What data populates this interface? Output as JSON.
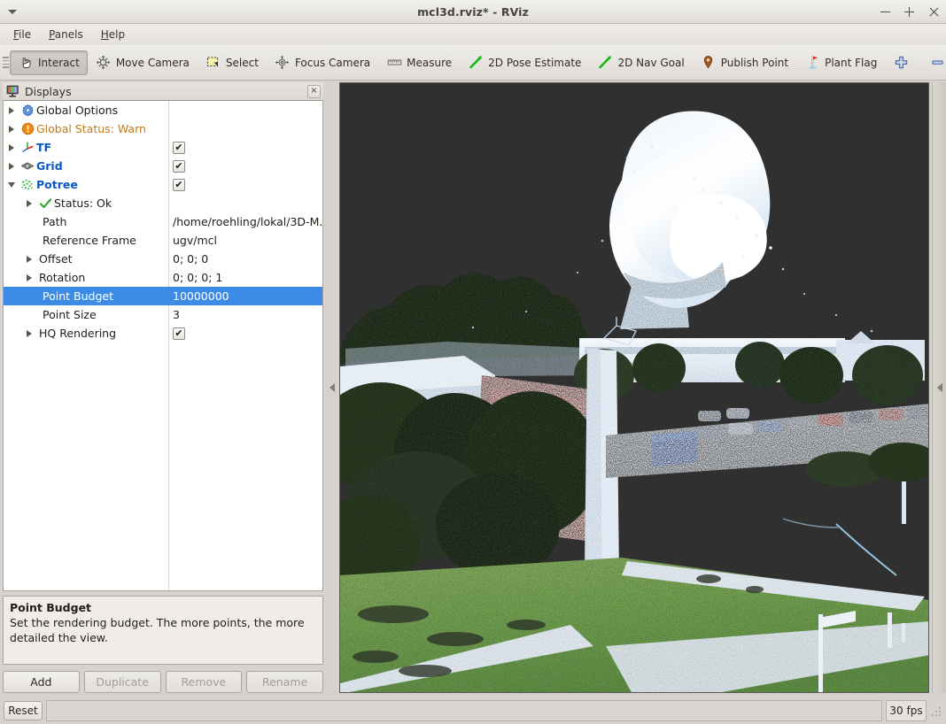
{
  "window": {
    "title": "mcl3d.rviz* - RViz",
    "minimize_label": "–",
    "maximize_label": "+",
    "close_label": "×"
  },
  "menubar": {
    "items": [
      {
        "label": "File"
      },
      {
        "label": "Panels"
      },
      {
        "label": "Help"
      }
    ]
  },
  "toolbar": {
    "items": [
      {
        "label": "Interact",
        "icon": "hand-cursor-icon",
        "checked": true
      },
      {
        "label": "Move Camera",
        "icon": "move-camera-icon",
        "checked": false
      },
      {
        "label": "Select",
        "icon": "select-rect-icon",
        "checked": false
      },
      {
        "label": "Focus Camera",
        "icon": "focus-camera-icon",
        "checked": false
      },
      {
        "label": "Measure",
        "icon": "ruler-icon",
        "checked": false
      },
      {
        "label": "2D Pose Estimate",
        "icon": "pose-arrow-icon",
        "checked": false
      },
      {
        "label": "2D Nav Goal",
        "icon": "nav-goal-arrow-icon",
        "checked": false
      },
      {
        "label": "Publish Point",
        "icon": "map-pin-icon",
        "checked": false
      },
      {
        "label": "Plant Flag",
        "icon": "flag-icon",
        "checked": false
      }
    ],
    "add_tool_label": "",
    "remove_tool_label": ""
  },
  "displays_panel": {
    "title": "Displays",
    "close_label": "×",
    "tree": [
      {
        "name": "Global Options",
        "value": "",
        "expander": "right",
        "icon": "gear-icon",
        "style": "plain",
        "checkbox": null,
        "indent": 0,
        "selected": false
      },
      {
        "name": "Global Status: Warn",
        "value": "",
        "expander": "right",
        "icon": "warning-icon",
        "style": "warn",
        "checkbox": null,
        "indent": 0,
        "selected": false
      },
      {
        "name": "TF",
        "value": "",
        "expander": "right",
        "icon": "tf-axes-icon",
        "style": "blue",
        "checkbox": true,
        "indent": 0,
        "selected": false
      },
      {
        "name": "Grid",
        "value": "",
        "expander": "right",
        "icon": "grid-icon",
        "style": "blue",
        "checkbox": true,
        "indent": 0,
        "selected": false
      },
      {
        "name": "Potree",
        "value": "",
        "expander": "down",
        "icon": "pointcloud-icon",
        "style": "blue",
        "checkbox": true,
        "indent": 0,
        "selected": false
      },
      {
        "name": "Status: Ok",
        "value": "",
        "expander": "right",
        "icon": "check-icon",
        "style": "plain",
        "checkbox": null,
        "indent": 1,
        "selected": false
      },
      {
        "name": "Path",
        "value": "/home/roehling/lokal/3D-M...",
        "expander": "none",
        "icon": "none",
        "style": "plain",
        "checkbox": null,
        "indent": 1,
        "selected": false
      },
      {
        "name": "Reference Frame",
        "value": "ugv/mcl",
        "expander": "none",
        "icon": "none",
        "style": "plain",
        "checkbox": null,
        "indent": 1,
        "selected": false
      },
      {
        "name": "Offset",
        "value": "0; 0; 0",
        "expander": "right",
        "icon": "none",
        "style": "plain",
        "checkbox": null,
        "indent": 1,
        "selected": false
      },
      {
        "name": "Rotation",
        "value": "0; 0; 0; 1",
        "expander": "right",
        "icon": "none",
        "style": "plain",
        "checkbox": null,
        "indent": 1,
        "selected": false
      },
      {
        "name": "Point Budget",
        "value": "10000000",
        "expander": "none",
        "icon": "none",
        "style": "plain",
        "checkbox": null,
        "indent": 1,
        "selected": true
      },
      {
        "name": "Point Size",
        "value": "3",
        "expander": "none",
        "icon": "none",
        "style": "plain",
        "checkbox": null,
        "indent": 1,
        "selected": false
      },
      {
        "name": "HQ Rendering",
        "value": "",
        "expander": "right",
        "icon": "none",
        "style": "plain",
        "checkbox": true,
        "indent": 1,
        "selected": false
      }
    ],
    "help": {
      "title": "Point Budget",
      "text": "Set the rendering budget. The more points, the more detailed the view."
    },
    "buttons": [
      {
        "label": "Add",
        "enabled": true
      },
      {
        "label": "Duplicate",
        "enabled": false
      },
      {
        "label": "Remove",
        "enabled": false
      },
      {
        "label": "Rename",
        "enabled": false
      }
    ]
  },
  "viewport": {
    "background_color": "#303030",
    "description": "3D point cloud render of an outdoor campus scene: green lawn in foreground, paved walkways, trees, parked cars, buildings and a large white satellite dish antenna against a dark sky"
  },
  "statusbar": {
    "reset_label": "Reset",
    "message": "",
    "fps": "30 fps"
  },
  "colors": {
    "selection_blue": "#3c8ce7",
    "display_name_blue": "#0a56c4",
    "warn_orange": "#c07a18",
    "viewport_bg": "#303030",
    "panel_bg": "#d6d2cd"
  }
}
